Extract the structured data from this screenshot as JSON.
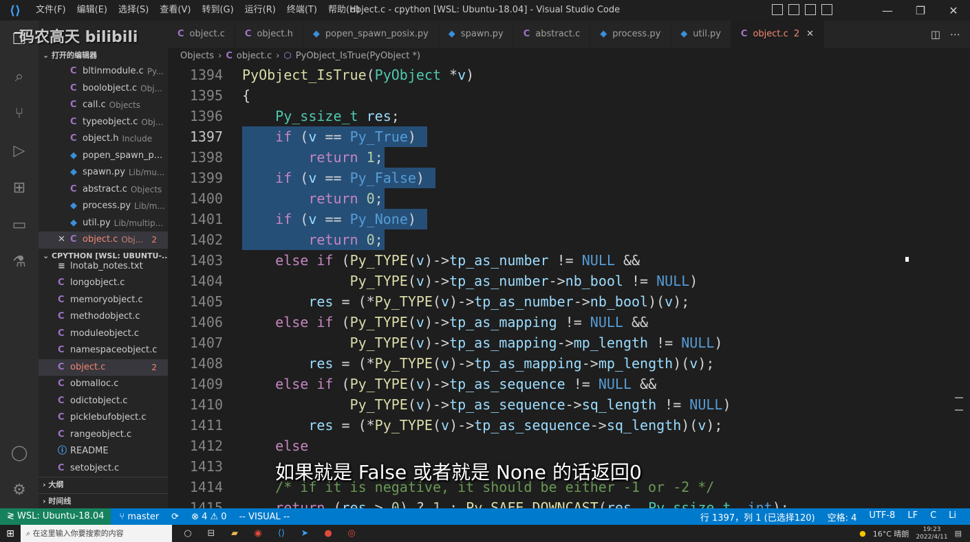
{
  "titlebar": {
    "menus": [
      "文件(F)",
      "编辑(E)",
      "选择(S)",
      "查看(V)",
      "转到(G)",
      "运行(R)",
      "终端(T)",
      "帮助(H)"
    ],
    "title": "object.c - cpython [WSL: Ubuntu-18.04] - Visual Studio Code"
  },
  "watermark": "码农高天 bilibili",
  "sidebar": {
    "open_editors_title": "打开的编辑器",
    "open_editors": [
      {
        "icon": "C",
        "name": "bltinmodule.c",
        "desc": "Py..."
      },
      {
        "icon": "C",
        "name": "boolobject.c",
        "desc": "Obj..."
      },
      {
        "icon": "C",
        "name": "call.c",
        "desc": "Objects"
      },
      {
        "icon": "C",
        "name": "typeobject.c",
        "desc": "Obj..."
      },
      {
        "icon": "C",
        "name": "object.h",
        "desc": "Include"
      },
      {
        "icon": "py",
        "name": "popen_spawn_p...",
        "desc": ""
      },
      {
        "icon": "py",
        "name": "spawn.py",
        "desc": "Lib/mu..."
      },
      {
        "icon": "C",
        "name": "abstract.c",
        "desc": "Objects"
      },
      {
        "icon": "py",
        "name": "process.py",
        "desc": "Lib/m..."
      },
      {
        "icon": "py",
        "name": "util.py",
        "desc": "Lib/multip..."
      }
    ],
    "open_active": {
      "close": "✕",
      "icon": "C",
      "name": "object.c",
      "desc": "Obj...",
      "badge": "2"
    },
    "workspace_title": "CPYTHON [WSL: UBUNTU-...",
    "files": [
      {
        "icon": "txt",
        "name": "lnotab_notes.txt",
        "badge": ""
      },
      {
        "icon": "C",
        "name": "longobject.c",
        "badge": ""
      },
      {
        "icon": "C",
        "name": "memoryobject.c",
        "badge": ""
      },
      {
        "icon": "C",
        "name": "methodobject.c",
        "badge": ""
      },
      {
        "icon": "C",
        "name": "moduleobject.c",
        "badge": ""
      },
      {
        "icon": "C",
        "name": "namespaceobject.c",
        "badge": ""
      },
      {
        "icon": "C",
        "name": "object.c",
        "badge": "2"
      },
      {
        "icon": "C",
        "name": "obmalloc.c",
        "badge": ""
      },
      {
        "icon": "C",
        "name": "odictobject.c",
        "badge": ""
      },
      {
        "icon": "C",
        "name": "picklebufobject.c",
        "badge": ""
      },
      {
        "icon": "C",
        "name": "rangeobject.c",
        "badge": ""
      },
      {
        "icon": "info",
        "name": "README",
        "badge": ""
      },
      {
        "icon": "C",
        "name": "setobject.c",
        "badge": ""
      }
    ],
    "outline_title": "大纲",
    "timeline_title": "时间线"
  },
  "tabs": [
    {
      "icon": "C",
      "label": "object.c"
    },
    {
      "icon": "C",
      "label": "object.h"
    },
    {
      "icon": "py",
      "label": "popen_spawn_posix.py"
    },
    {
      "icon": "py",
      "label": "spawn.py"
    },
    {
      "icon": "C",
      "label": "abstract.c"
    },
    {
      "icon": "py",
      "label": "process.py"
    },
    {
      "icon": "py",
      "label": "util.py"
    }
  ],
  "active_tab": {
    "icon": "C",
    "label": "object.c",
    "badge": "2",
    "close": "✕"
  },
  "breadcrumb": {
    "folder": "Objects",
    "file": "object.c",
    "symbol": "PyObject_IsTrue(PyObject *)"
  },
  "editor": {
    "line_numbers": [
      "1394",
      "1395",
      "1396",
      "1397",
      "1398",
      "1399",
      "1400",
      "1401",
      "1402",
      "1403",
      "1404",
      "1405",
      "1406",
      "1407",
      "1408",
      "1409",
      "1410",
      "1411",
      "1412",
      "1413",
      "1414",
      "1415"
    ],
    "current_line": "1397"
  },
  "subtitle": "如果就是 False 或者就是 None 的话返回0",
  "statusbar": {
    "remote": "WSL: Ubuntu-18.04",
    "branch": "master",
    "sync": "⟳",
    "problems": "⊗ 4 ⚠ 0",
    "mode": "-- VISUAL --",
    "position": "行 1397，列 1 (已选择120)",
    "spaces": "空格: 4",
    "encoding": "UTF-8",
    "eol": "LF",
    "language": "C",
    "extra": "Li"
  },
  "taskbar": {
    "search_placeholder": "在这里输入你要搜索的内容",
    "weather": "16°C 晴朗",
    "time": "19:23",
    "date": "2022/4/11"
  },
  "colors": {
    "accent": "#007acc",
    "remote": "#16825d",
    "selection": "#264f78",
    "error": "#f48771"
  }
}
